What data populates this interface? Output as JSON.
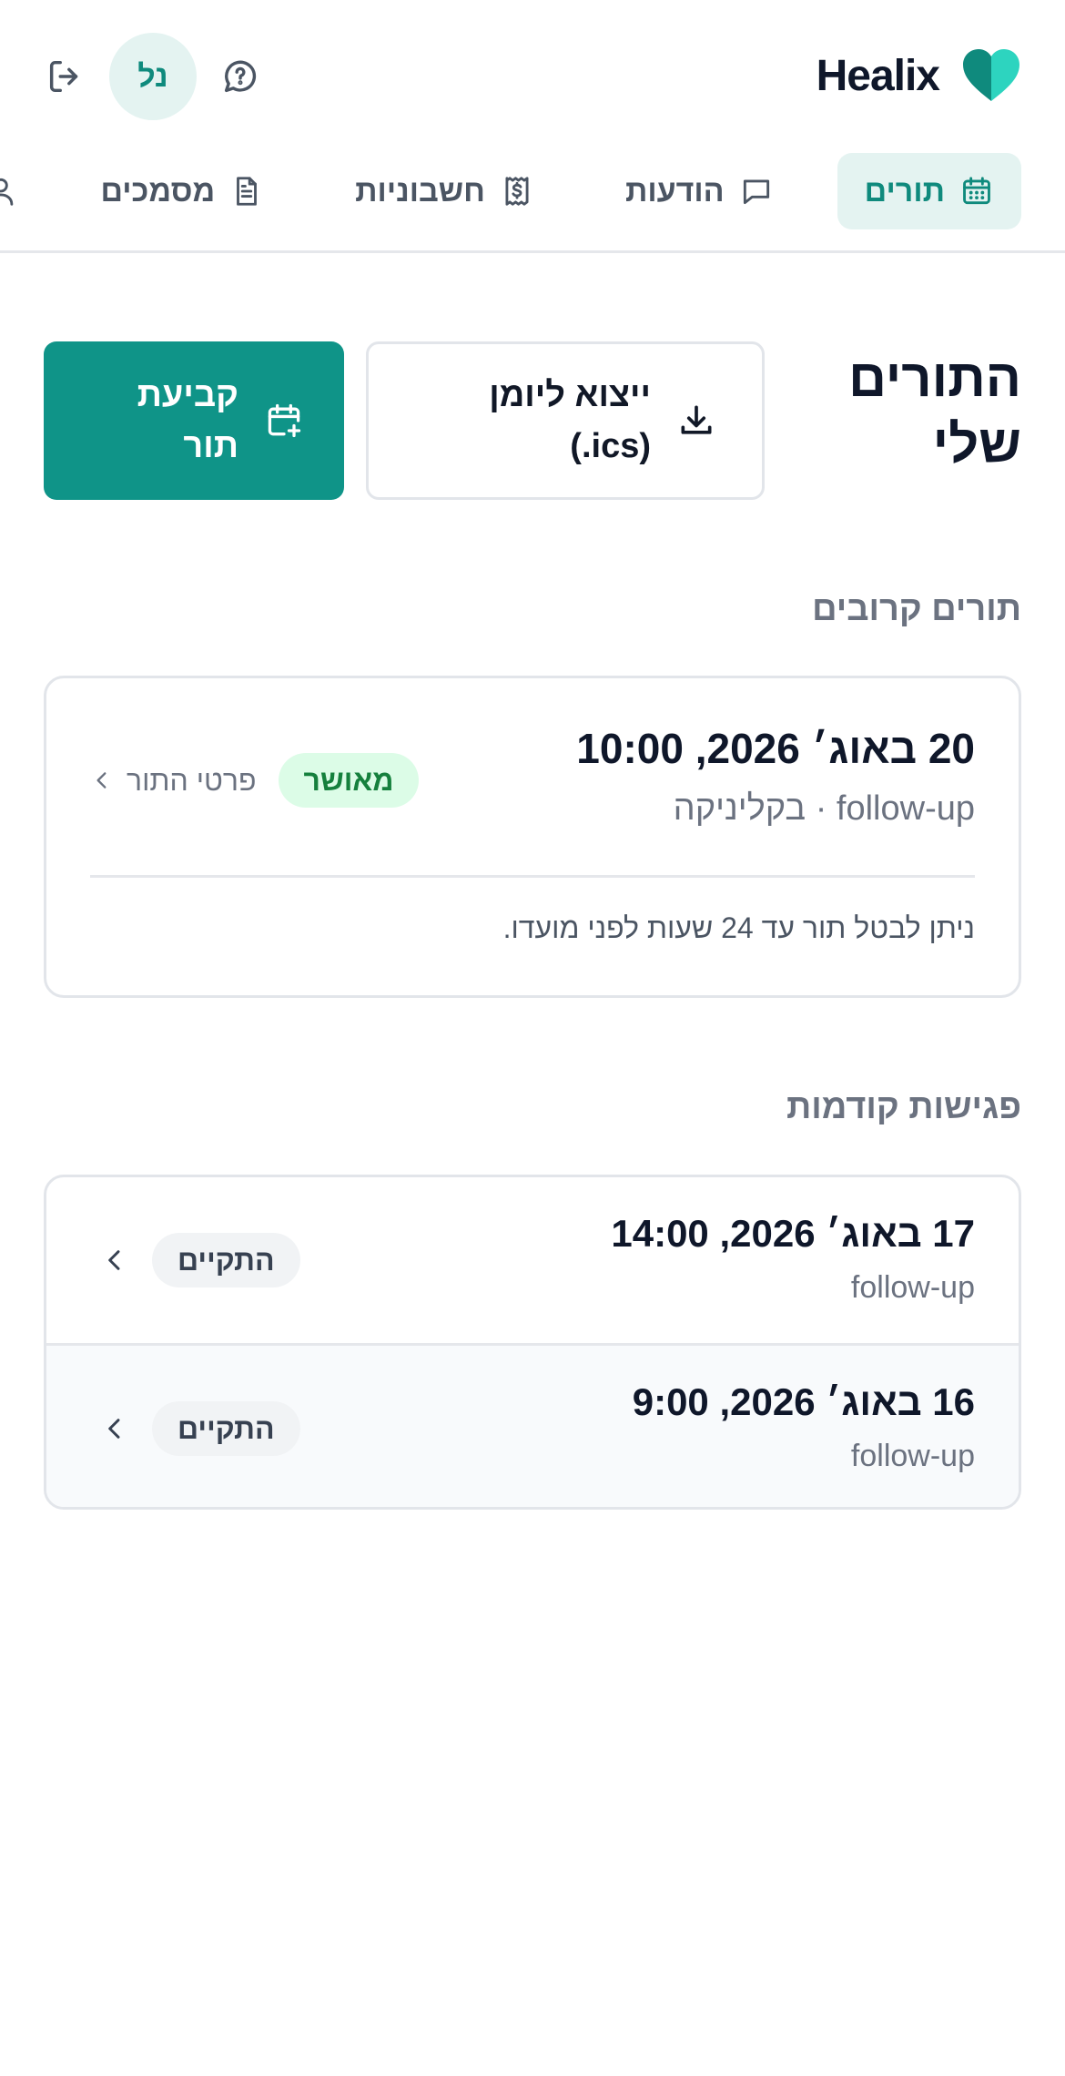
{
  "app": {
    "brand": "Healix",
    "avatar_initials": "נל",
    "colors": {
      "accent": "#0f9488",
      "accent_soft": "#e4f3f1",
      "success_bg": "#dcfce7",
      "success_text": "#15803d"
    }
  },
  "nav": {
    "items": [
      {
        "label": "תורים",
        "icon": "calendar-icon",
        "active": true
      },
      {
        "label": "הודעות",
        "icon": "message-icon",
        "active": false
      },
      {
        "label": "חשבוניות",
        "icon": "receipt-icon",
        "active": false
      },
      {
        "label": "מסמכים",
        "icon": "document-icon",
        "active": false
      }
    ],
    "profile_icon": "user-icon",
    "support_icon": "chat-help-icon",
    "logout_icon": "logout-icon"
  },
  "page": {
    "title": "התורים שלי",
    "export_label": "ייצוא ליומן (ics.)",
    "book_label": "קביעת תור"
  },
  "upcoming": {
    "section_title": "תורים קרובים",
    "date": "20 באוג׳ 2026, 10:00",
    "subtitle": "follow-up · בקליניקה",
    "status": "מאושר",
    "details_label": "פרטי התור",
    "note": "ניתן לבטל תור עד 24 שעות לפני מועדו."
  },
  "past": {
    "section_title": "פגישות קודמות",
    "items": [
      {
        "date": "17 באוג׳ 2026, 14:00",
        "type": "follow-up",
        "status": "התקיים"
      },
      {
        "date": "16 באוג׳ 2026, 9:00",
        "type": "follow-up",
        "status": "התקיים"
      }
    ]
  }
}
